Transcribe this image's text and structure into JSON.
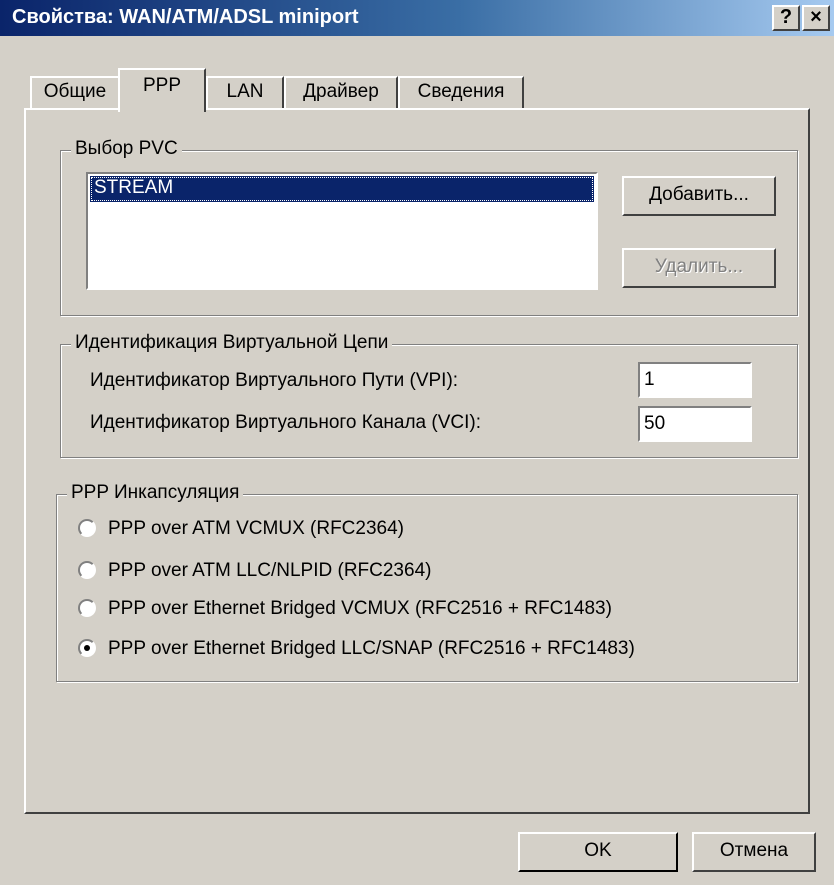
{
  "window": {
    "title": "Свойства: WAN/ATM/ADSL miniport",
    "help_button": "?",
    "close_button": "×"
  },
  "tabs": [
    {
      "label": "Общие"
    },
    {
      "label": "PPP"
    },
    {
      "label": "LAN"
    },
    {
      "label": "Драйвер"
    },
    {
      "label": "Сведения"
    }
  ],
  "active_tab": "PPP",
  "pvc_group": {
    "label": "Выбор PVC",
    "items": [
      "STREAM"
    ],
    "add_button": "Добавить...",
    "remove_button": "Удалить..."
  },
  "vc_group": {
    "label": "Идентификация Виртуальной Цепи",
    "vpi_label": "Идентификатор Виртуального Пути (VPI):",
    "vpi_value": "1",
    "vci_label": "Идентификатор Виртуального Канала (VCI):",
    "vci_value": "50"
  },
  "encap_group": {
    "label": "PPP Инкапсуляция",
    "options": [
      {
        "label": "PPP over ATM VCMUX (RFC2364)",
        "selected": false
      },
      {
        "label": "PPP over ATM LLC/NLPID (RFC2364)",
        "selected": false
      },
      {
        "label": "PPP over Ethernet Bridged VCMUX (RFC2516 + RFC1483)",
        "selected": false
      },
      {
        "label": "PPP over Ethernet Bridged LLC/SNAP (RFC2516 + RFC1483)",
        "selected": true
      }
    ]
  },
  "footer": {
    "ok_label": "OK",
    "cancel_label": "Отмена"
  },
  "colors": {
    "titlebar_start": "#0a246a",
    "titlebar_end": "#a6caf0",
    "face": "#d4d0c8",
    "selection": "#0a246a"
  }
}
